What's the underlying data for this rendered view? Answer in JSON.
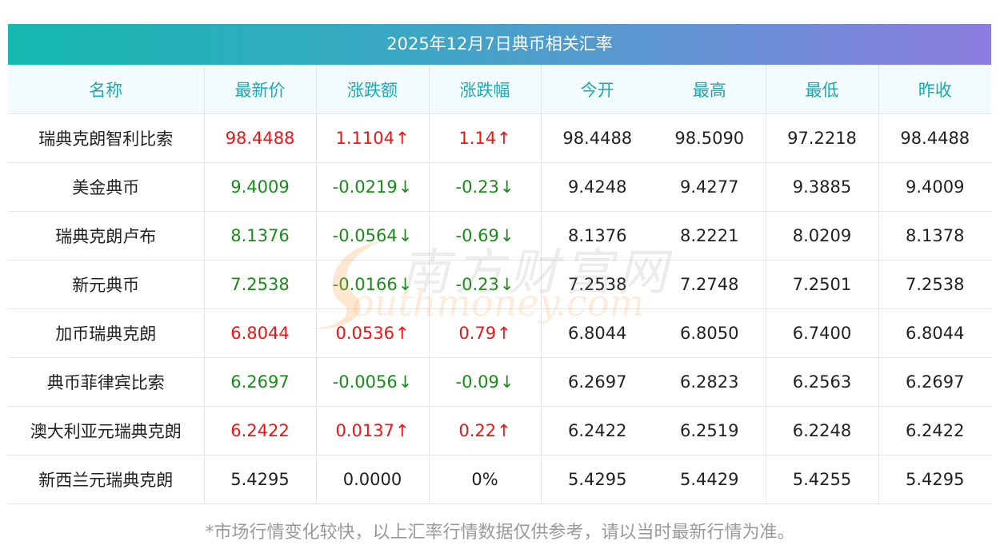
{
  "title": "2025年12月7日典币相关汇率",
  "headers": [
    "名称",
    "最新价",
    "涨跌额",
    "涨跌幅",
    "今开",
    "最高",
    "最低",
    "昨收"
  ],
  "rows": [
    {
      "name": "瑞典克朗智利比索",
      "latest": "98.4488",
      "change": "1.1104",
      "pct": "1.14",
      "open": "98.4488",
      "high": "98.5090",
      "low": "97.2218",
      "prev": "98.4488",
      "dir": "up"
    },
    {
      "name": "美金典币",
      "latest": "9.4009",
      "change": "-0.0219",
      "pct": "-0.23",
      "open": "9.4248",
      "high": "9.4277",
      "low": "9.3885",
      "prev": "9.4009",
      "dir": "down"
    },
    {
      "name": "瑞典克朗卢布",
      "latest": "8.1376",
      "change": "-0.0564",
      "pct": "-0.69",
      "open": "8.1376",
      "high": "8.2221",
      "low": "8.0209",
      "prev": "8.1378",
      "dir": "down"
    },
    {
      "name": "新元典币",
      "latest": "7.2538",
      "change": "-0.0166",
      "pct": "-0.23",
      "open": "7.2538",
      "high": "7.2748",
      "low": "7.2501",
      "prev": "7.2538",
      "dir": "down"
    },
    {
      "name": "加币瑞典克朗",
      "latest": "6.8044",
      "change": "0.0536",
      "pct": "0.79",
      "open": "6.8044",
      "high": "6.8050",
      "low": "6.7400",
      "prev": "6.8044",
      "dir": "up"
    },
    {
      "name": "典币菲律宾比索",
      "latest": "6.2697",
      "change": "-0.0056",
      "pct": "-0.09",
      "open": "6.2697",
      "high": "6.2823",
      "low": "6.2563",
      "prev": "6.2697",
      "dir": "down"
    },
    {
      "name": "澳大利亚元瑞典克朗",
      "latest": "6.2422",
      "change": "0.0137",
      "pct": "0.22",
      "open": "6.2422",
      "high": "6.2519",
      "low": "6.2248",
      "prev": "6.2422",
      "dir": "up"
    },
    {
      "name": "新西兰元瑞典克朗",
      "latest": "5.4295",
      "change": "0.0000",
      "pct": "0%",
      "open": "5.4295",
      "high": "5.4429",
      "low": "5.4255",
      "prev": "5.4295",
      "dir": "flat"
    }
  ],
  "arrows": {
    "up": "↑",
    "down": "↓"
  },
  "watermark": {
    "cn": "南方财富网",
    "en": "outhmoney.com"
  },
  "footnote": "*市场行情变化较快，以上汇率行情数据仅供参考，请以当时最新行情为准。",
  "colors": {
    "up": "#f01414",
    "down": "#1b8a1b",
    "header_text": "#1aaab4",
    "title_gradient_start": "#15b9b0",
    "title_gradient_end": "#8d7de0"
  }
}
